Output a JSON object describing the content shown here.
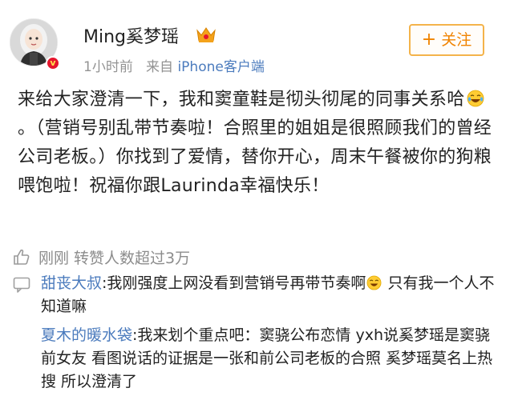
{
  "header": {
    "username": "Ming奚梦瑶",
    "time": "1小时前",
    "source_prefix": "来自",
    "source": "iPhone客户端",
    "follow_plus": "+",
    "follow_label": "关注",
    "verified_badge": "v",
    "crown_icon": "crown-badge-icon"
  },
  "post": {
    "text_part1": "来给大家澄清一下，我和窦童鞋是彻头彻尾的同事关系哈",
    "emoji": "laugh-cry-emoji",
    "text_part2": "。（营销号别乱带节奏啦！合照里的姐姐是很照顾我们的曾经公司老板。）你找到了爱情，替你开心，周末午餐被你的狗粮喂饱啦！祝福你跟Laurinda幸福快乐！"
  },
  "stats": {
    "icon": "thumb-up-icon",
    "text": "刚刚 转赞人数超过3万"
  },
  "comments": [
    {
      "author": "甜丧大叔",
      "text_before_emoji": ":我刚强度上网没看到营销号再带节奏啊",
      "emoji": "laugh-emoji",
      "text_after_emoji": " 只有我一个人不知道嘛"
    },
    {
      "author": "夏木的暖水袋",
      "text_before_emoji": ":我来划个重点吧：窦骁公布恋情 yxh说奚梦瑶是窦骁前女友 看图说话的证据是一张和前公司老板的合照 奚梦瑶莫名上热搜 所以澄清了",
      "emoji": "",
      "text_after_emoji": ""
    }
  ],
  "colors": {
    "link_blue": "#4b7bbd",
    "follow_orange": "#f08300",
    "meta_gray": "#939393",
    "verified_red": "#e6162d"
  }
}
